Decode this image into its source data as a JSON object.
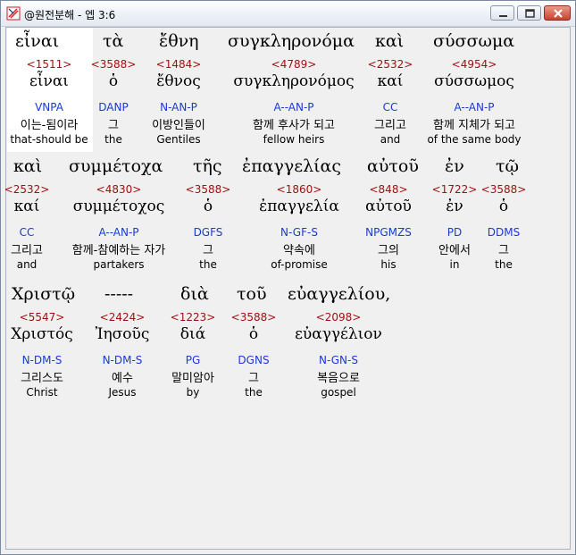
{
  "window": {
    "title": "@원전분해 - 엡 3:6"
  },
  "rows": [
    [
      {
        "g1": "εἶναι",
        "num": "<1511>",
        "g2": "εἶναι",
        "pars": "VNPA",
        "kor": "이는-됨이라",
        "eng": "that-should be"
      },
      {
        "g1": "τὰ",
        "num": "<3588>",
        "g2": "ὁ",
        "pars": "DANP",
        "kor": "그",
        "eng": "the"
      },
      {
        "g1": "ἔθνη",
        "num": "<1484>",
        "g2": "ἔθνος",
        "pars": "N-AN-P",
        "kor": "이방인들이",
        "eng": "Gentiles"
      },
      {
        "g1": "συγκληρονόμα",
        "num": "<4789>",
        "g2": "συγκληρονόμος",
        "pars": "A--AN-P",
        "kor": "함께 후사가 되고",
        "eng": "fellow heirs"
      },
      {
        "g1": "καὶ",
        "num": "<2532>",
        "g2": "καί",
        "pars": "CC",
        "kor": "그리고",
        "eng": "and"
      },
      {
        "g1": "σύσσωμα",
        "num": "<4954>",
        "g2": "σύσσωμος",
        "pars": "A--AN-P",
        "kor": "함께 지체가 되고",
        "eng": "of the same body"
      }
    ],
    [
      {
        "g1": "καὶ",
        "num": "<2532>",
        "g2": "καί",
        "pars": "CC",
        "kor": "그리고",
        "eng": "and"
      },
      {
        "g1": "συμμέτοχα",
        "num": "<4830>",
        "g2": "συμμέτοχος",
        "pars": "A--AN-P",
        "kor": "함께-참예하는 자가",
        "eng": "partakers"
      },
      {
        "g1": "τῆς",
        "num": "<3588>",
        "g2": "ὁ",
        "pars": "DGFS",
        "kor": "그",
        "eng": "the"
      },
      {
        "g1": "ἐπαγγελίας",
        "num": "<1860>",
        "g2": "ἐπαγγελία",
        "pars": "N-GF-S",
        "kor": "약속에",
        "eng": "of-promise"
      },
      {
        "g1": "αὐτοῦ",
        "num": "<848>",
        "g2": "αὐτοῦ",
        "pars": "NPGMZS",
        "kor": "그의",
        "eng": "his"
      },
      {
        "g1": "ἐν",
        "num": "<1722>",
        "g2": "ἐν",
        "pars": "PD",
        "kor": "안에서",
        "eng": "in"
      },
      {
        "g1": "τῷ",
        "num": "<3588>",
        "g2": "ὁ",
        "pars": "DDMS",
        "kor": "그",
        "eng": "the"
      }
    ],
    [
      {
        "g1": "Χριστῷ",
        "num": "<5547>",
        "g2": "Χριστός",
        "pars": "N-DM-S",
        "kor": "그리스도",
        "eng": "Christ"
      },
      {
        "g1": "-----",
        "num": "<2424>",
        "g2": "Ἰησοῦς",
        "pars": "N-DM-S",
        "kor": "예수",
        "eng": "Jesus"
      },
      {
        "g1": "διὰ",
        "num": "<1223>",
        "g2": "διά",
        "pars": "PG",
        "kor": "말미암아",
        "eng": "by"
      },
      {
        "g1": "τοῦ",
        "num": "<3588>",
        "g2": "ὁ",
        "pars": "DGNS",
        "kor": "그",
        "eng": "the"
      },
      {
        "g1": "εὐαγγελίου,",
        "num": "<2098>",
        "g2": "εὐαγγέλιον",
        "pars": "N-GN-S",
        "kor": "복음으로",
        "eng": "gospel"
      }
    ]
  ]
}
